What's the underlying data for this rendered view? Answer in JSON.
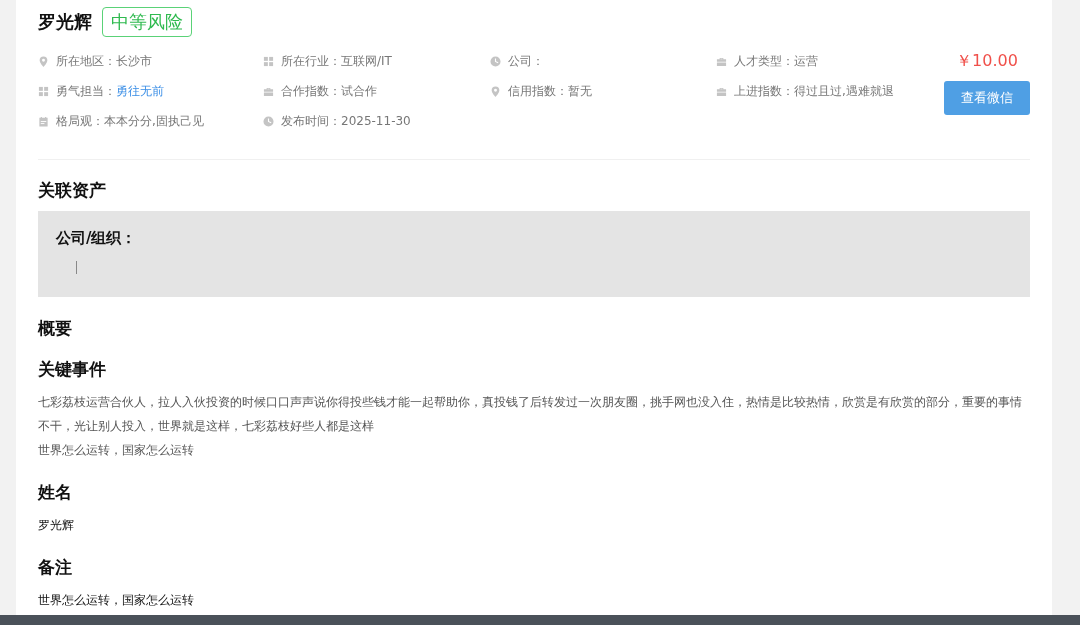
{
  "header": {
    "name": "罗光辉",
    "risk_badge": "中等风险"
  },
  "info": [
    {
      "kind": "location",
      "label": "所在地区：",
      "value": "长沙市",
      "highlighted": false
    },
    {
      "kind": "grid",
      "label": "所在行业：",
      "value": "互联网/IT",
      "highlighted": false
    },
    {
      "kind": "clock",
      "label": "公司："
    },
    {
      "kind": "briefcase",
      "label": "人才类型：",
      "value": "运营",
      "highlighted": false
    },
    {
      "kind": "grid",
      "label": "勇气担当：",
      "value": "勇往无前",
      "highlighted": true
    },
    {
      "kind": "briefcase",
      "label": "合作指数：",
      "value": "试合作",
      "highlighted": false
    },
    {
      "kind": "location",
      "label": "信用指数：",
      "value": "暂无",
      "highlighted": false
    },
    {
      "kind": "briefcase",
      "label": "上进指数：",
      "value": "得过且过,遇难就退",
      "highlighted": false
    },
    {
      "kind": "calendar",
      "label": "格局观：",
      "value": "本本分分,固执己见",
      "highlighted": false
    },
    {
      "kind": "clock",
      "label": "发布时间：",
      "value": "2025-11-30",
      "highlighted": false
    }
  ],
  "price": "￥10.00",
  "action_button": "查看微信",
  "related_assets": {
    "title": "关联资产",
    "box_label": "公司/组织："
  },
  "sections": [
    {
      "title": "概要"
    },
    {
      "title": "关键事件",
      "paragraphs": [
        "七彩荔枝运营合伙人，拉人入伙投资的时候口口声声说你得投些钱才能一起帮助你，真投钱了后转发过一次朋友圈，挑手网也没入住，热情是比较热情，欣赏是有欣赏的部分，重要的事情不干，光让别人投入，世界就是这样，七彩荔枝好些人都是这样",
        "世界怎么运转，国家怎么运转"
      ],
      "kind": "muted"
    },
    {
      "title": "姓名",
      "paragraphs": [
        "罗光辉"
      ],
      "kind": "plain"
    },
    {
      "title": "备注",
      "paragraphs": [
        "世界怎么运转，国家怎么运转"
      ],
      "kind": "plain"
    }
  ]
}
